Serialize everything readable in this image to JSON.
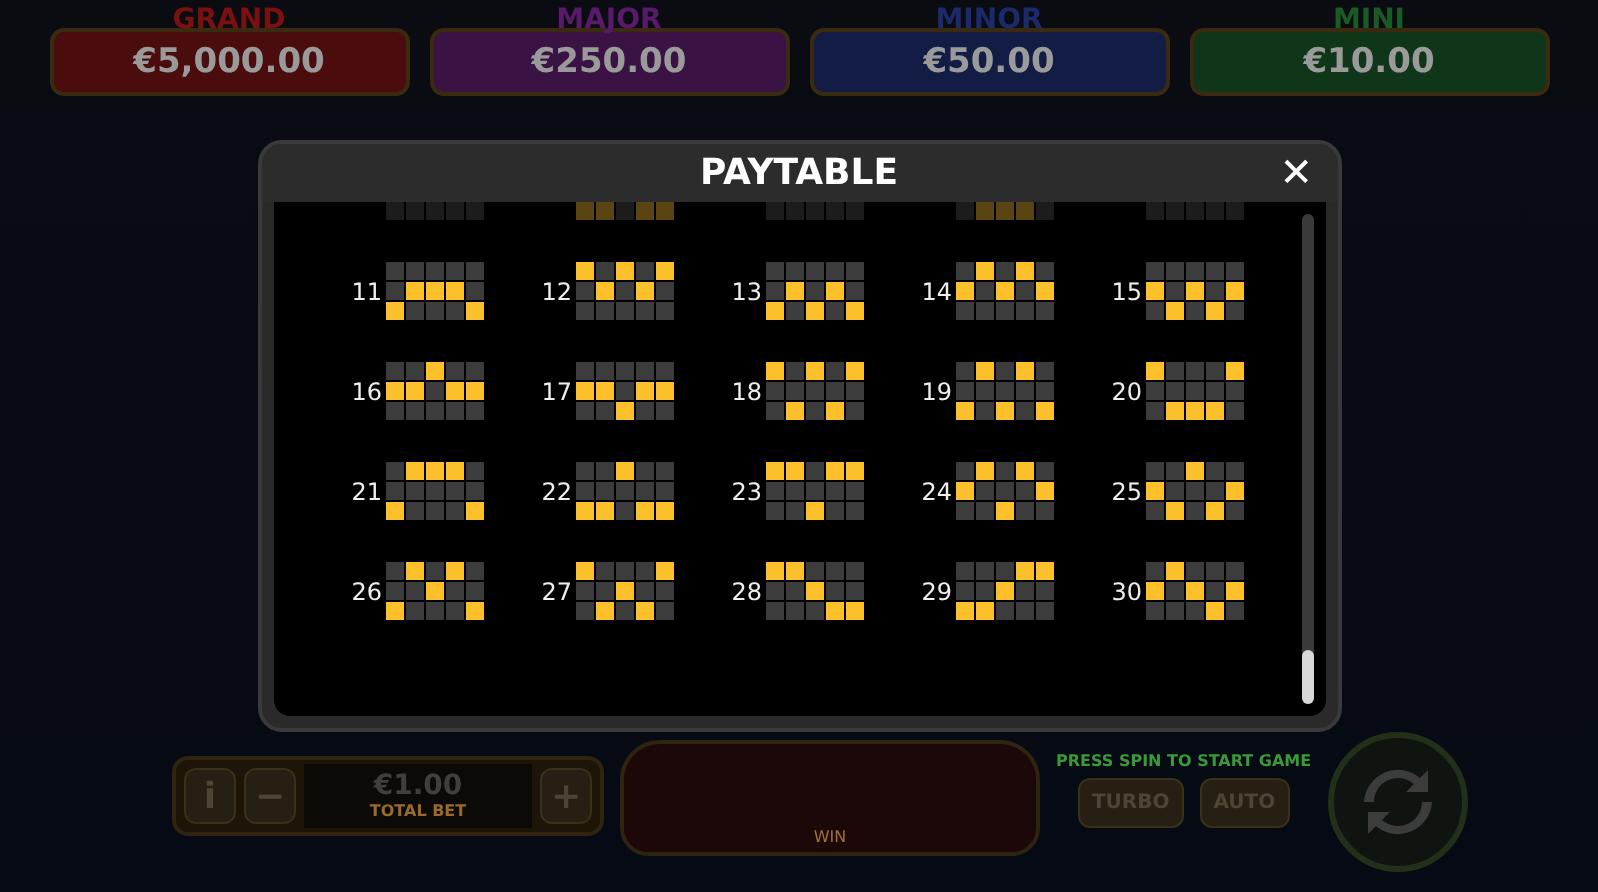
{
  "jackpots": [
    {
      "kind": "grand",
      "label": "GRAND",
      "amount": "€5,000.00",
      "color": "#7a1010"
    },
    {
      "kind": "major",
      "label": "MAJOR",
      "amount": "€250.00",
      "color": "#5a1a6a"
    },
    {
      "kind": "minor",
      "label": "MINOR",
      "amount": "€50.00",
      "color": "#1a2a6a"
    },
    {
      "kind": "mini",
      "label": "MINI",
      "amount": "€10.00",
      "color": "#1a5a24"
    }
  ],
  "paytable": {
    "title": "PAYTABLE",
    "close": "✕",
    "partial_lines": [
      [
        false,
        false,
        false,
        false,
        false
      ],
      [
        true,
        true,
        false,
        true,
        true
      ],
      [
        false,
        false,
        false,
        false,
        false
      ],
      [
        false,
        true,
        true,
        true,
        false
      ],
      [
        false,
        false,
        false,
        false,
        false
      ]
    ],
    "lines": [
      {
        "number": "11",
        "lit": [
          [
            false,
            false,
            false,
            false,
            false
          ],
          [
            false,
            true,
            true,
            true,
            false
          ],
          [
            true,
            false,
            false,
            false,
            true
          ]
        ]
      },
      {
        "number": "12",
        "lit": [
          [
            true,
            false,
            true,
            false,
            true
          ],
          [
            false,
            true,
            false,
            true,
            false
          ],
          [
            false,
            false,
            false,
            false,
            false
          ]
        ]
      },
      {
        "number": "13",
        "lit": [
          [
            false,
            false,
            false,
            false,
            false
          ],
          [
            false,
            true,
            false,
            true,
            false
          ],
          [
            true,
            false,
            true,
            false,
            true
          ]
        ]
      },
      {
        "number": "14",
        "lit": [
          [
            false,
            true,
            false,
            true,
            false
          ],
          [
            true,
            false,
            true,
            false,
            true
          ],
          [
            false,
            false,
            false,
            false,
            false
          ]
        ]
      },
      {
        "number": "15",
        "lit": [
          [
            false,
            false,
            false,
            false,
            false
          ],
          [
            true,
            false,
            true,
            false,
            true
          ],
          [
            false,
            true,
            false,
            true,
            false
          ]
        ]
      },
      {
        "number": "16",
        "lit": [
          [
            false,
            false,
            true,
            false,
            false
          ],
          [
            true,
            true,
            false,
            true,
            true
          ],
          [
            false,
            false,
            false,
            false,
            false
          ]
        ]
      },
      {
        "number": "17",
        "lit": [
          [
            false,
            false,
            false,
            false,
            false
          ],
          [
            true,
            true,
            false,
            true,
            true
          ],
          [
            false,
            false,
            true,
            false,
            false
          ]
        ]
      },
      {
        "number": "18",
        "lit": [
          [
            true,
            false,
            true,
            false,
            true
          ],
          [
            false,
            false,
            false,
            false,
            false
          ],
          [
            false,
            true,
            false,
            true,
            false
          ]
        ]
      },
      {
        "number": "19",
        "lit": [
          [
            false,
            true,
            false,
            true,
            false
          ],
          [
            false,
            false,
            false,
            false,
            false
          ],
          [
            true,
            false,
            true,
            false,
            true
          ]
        ]
      },
      {
        "number": "20",
        "lit": [
          [
            true,
            false,
            false,
            false,
            true
          ],
          [
            false,
            false,
            false,
            false,
            false
          ],
          [
            false,
            true,
            true,
            true,
            false
          ]
        ]
      },
      {
        "number": "21",
        "lit": [
          [
            false,
            true,
            true,
            true,
            false
          ],
          [
            false,
            false,
            false,
            false,
            false
          ],
          [
            true,
            false,
            false,
            false,
            true
          ]
        ]
      },
      {
        "number": "22",
        "lit": [
          [
            false,
            false,
            true,
            false,
            false
          ],
          [
            false,
            false,
            false,
            false,
            false
          ],
          [
            true,
            true,
            false,
            true,
            true
          ]
        ]
      },
      {
        "number": "23",
        "lit": [
          [
            true,
            true,
            false,
            true,
            true
          ],
          [
            false,
            false,
            false,
            false,
            false
          ],
          [
            false,
            false,
            true,
            false,
            false
          ]
        ]
      },
      {
        "number": "24",
        "lit": [
          [
            false,
            true,
            false,
            true,
            false
          ],
          [
            true,
            false,
            false,
            false,
            true
          ],
          [
            false,
            false,
            true,
            false,
            false
          ]
        ]
      },
      {
        "number": "25",
        "lit": [
          [
            false,
            false,
            true,
            false,
            false
          ],
          [
            true,
            false,
            false,
            false,
            true
          ],
          [
            false,
            true,
            false,
            true,
            false
          ]
        ]
      },
      {
        "number": "26",
        "lit": [
          [
            false,
            true,
            false,
            true,
            false
          ],
          [
            false,
            false,
            true,
            false,
            false
          ],
          [
            true,
            false,
            false,
            false,
            true
          ]
        ]
      },
      {
        "number": "27",
        "lit": [
          [
            true,
            false,
            false,
            false,
            true
          ],
          [
            false,
            false,
            true,
            false,
            false
          ],
          [
            false,
            true,
            false,
            true,
            false
          ]
        ]
      },
      {
        "number": "28",
        "lit": [
          [
            true,
            true,
            false,
            false,
            false
          ],
          [
            false,
            false,
            true,
            false,
            false
          ],
          [
            false,
            false,
            false,
            true,
            true
          ]
        ]
      },
      {
        "number": "29",
        "lit": [
          [
            false,
            false,
            false,
            true,
            true
          ],
          [
            false,
            false,
            true,
            false,
            false
          ],
          [
            true,
            true,
            false,
            false,
            false
          ]
        ]
      },
      {
        "number": "30",
        "lit": [
          [
            false,
            true,
            false,
            false,
            false
          ],
          [
            true,
            false,
            true,
            false,
            true
          ],
          [
            false,
            false,
            false,
            true,
            false
          ]
        ]
      }
    ]
  },
  "controls": {
    "info": "i",
    "minus": "−",
    "bet": "€1.00",
    "bet_label": "TOTAL BET",
    "plus": "+",
    "win_label": "WIN",
    "hint": "PRESS SPIN TO START GAME",
    "turbo": "TURBO",
    "auto": "AUTO"
  }
}
